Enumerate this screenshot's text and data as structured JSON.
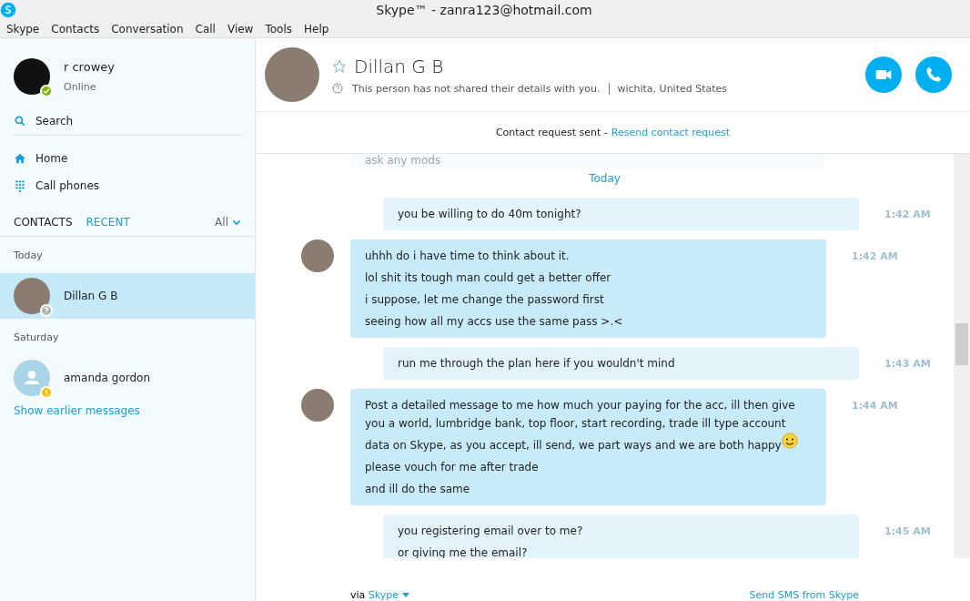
{
  "window": {
    "title": "Skype™ - zanra123@hotmail.com"
  },
  "menu": [
    "Skype",
    "Contacts",
    "Conversation",
    "Call",
    "View",
    "Tools",
    "Help"
  ],
  "profile": {
    "name": "r crowey",
    "status": "Online"
  },
  "nav": [
    {
      "label": "Search",
      "kind": "search"
    },
    {
      "label": "Home",
      "kind": "home"
    },
    {
      "label": "Call phones",
      "kind": "dialpad"
    }
  ],
  "tabs": [
    {
      "label": "CONTACTS",
      "selected": false
    },
    {
      "label": "RECENT",
      "selected": true
    }
  ],
  "filter": "All",
  "groups": [
    {
      "heading": "Today",
      "items": [
        {
          "name": "Dillan G B",
          "selected": true,
          "pending": false,
          "kind": "photo"
        }
      ]
    },
    {
      "heading": "Saturday",
      "items": [
        {
          "name": "amanda gordon",
          "selected": false,
          "pending": true,
          "kind": "generic"
        }
      ]
    }
  ],
  "show_earlier": "Show earlier messages",
  "contact": {
    "name": "Dillan G B",
    "favorite": false,
    "details": "This person has not shared their details with you.",
    "location": "wichita, United States"
  },
  "request": {
    "text": "Contact request sent -",
    "link": "Resend contact request"
  },
  "faded_message": "ask any mods",
  "day_label": "Today",
  "messages": [
    {
      "kind": "outgoing",
      "time": "1:42 AM",
      "lines": [
        {
          "text": "you be willing to do 40m tonight?",
          "smiley": false
        }
      ]
    },
    {
      "kind": "incoming",
      "time": "1:42 AM",
      "lines": [
        {
          "text": "uhhh do i have time to think about it.",
          "smiley": false
        },
        {
          "text": "lol shit its tough man could get a better offer",
          "smiley": false
        },
        {
          "text": "i suppose, let me change the password first",
          "smiley": false
        },
        {
          "text": "seeing how all my accs use the same pass >.<",
          "smiley": false
        }
      ]
    },
    {
      "kind": "outgoing",
      "time": "1:43 AM",
      "lines": [
        {
          "text": "run me through the plan here if you wouldn't mind",
          "smiley": false
        }
      ]
    },
    {
      "kind": "incoming",
      "time": "1:44 AM",
      "lines": [
        {
          "text": "Post a detailed message to me how much your paying for the acc, ill then give you a world, lumbridge bank, top floor, start recording, trade ill type account data on Skype, as you accept, ill send, we part ways and we are both happy",
          "smiley": true
        },
        {
          "text": "please vouch for me after trade",
          "smiley": false
        },
        {
          "text": "and ill do the same",
          "smiley": false
        }
      ]
    },
    {
      "kind": "outgoing",
      "time": "1:45 AM",
      "lines": [
        {
          "text": "you registering email over to me?",
          "smiley": false
        },
        {
          "text": "or giving me the email?",
          "smiley": false
        }
      ]
    }
  ],
  "footer": {
    "via": "via",
    "service": "Skype",
    "sms": "Send SMS from Skype"
  }
}
